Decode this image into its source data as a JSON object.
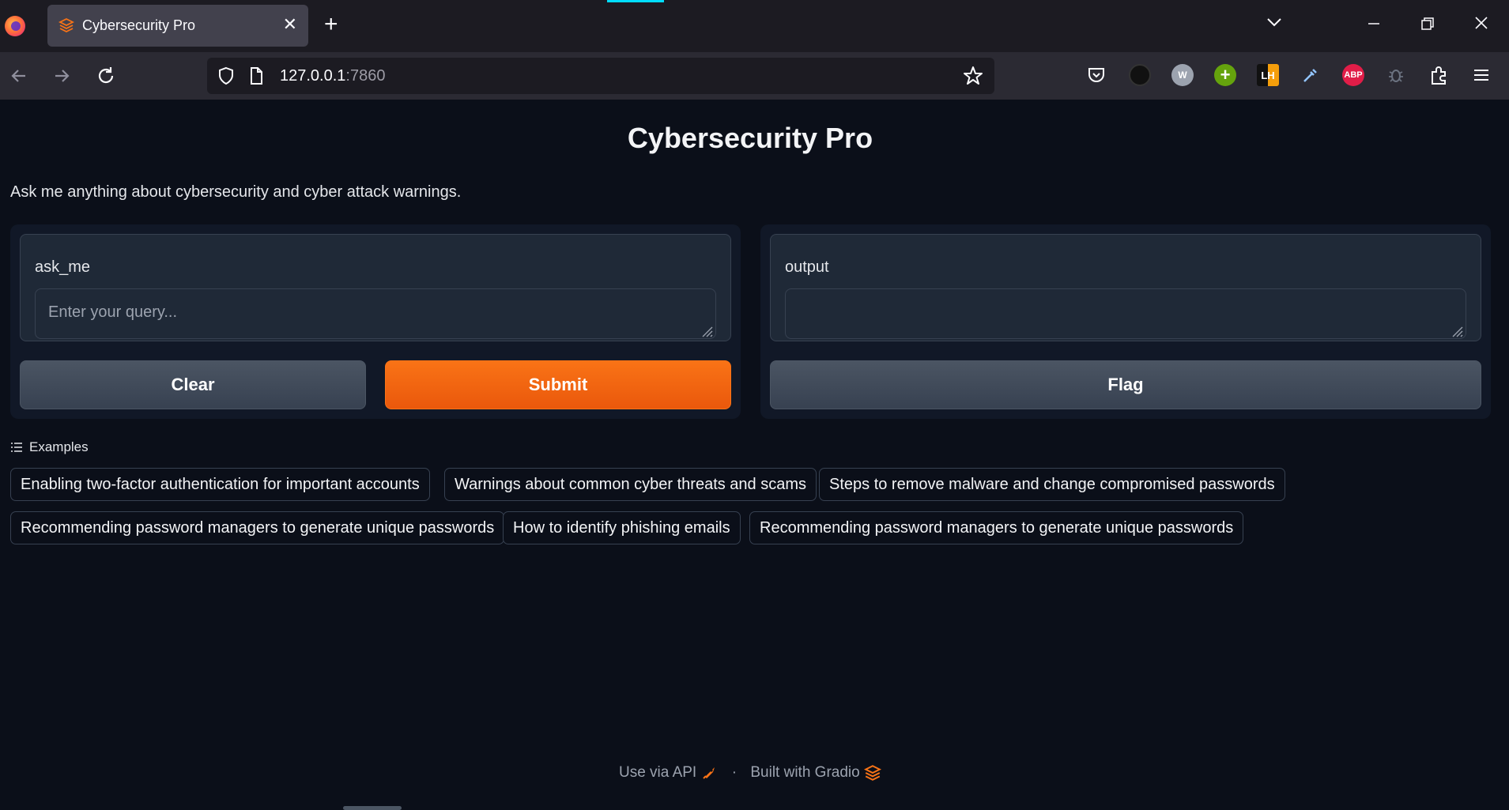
{
  "browser": {
    "tab_title": "Cybersecurity Pro",
    "url_host": "127.0.0.1",
    "url_port": ":7860",
    "extensions": [
      "pocket-icon",
      "dark-reader-icon",
      "w-extension-icon",
      "plus-extension-icon",
      "lighthouse-icon",
      "eyedropper-icon",
      "adblock-plus-icon",
      "bug-icon",
      "extensions-icon",
      "menu-icon"
    ],
    "adblock_label": "ABP",
    "w_label": "W",
    "lh_label": "LH"
  },
  "app": {
    "title": "Cybersecurity Pro",
    "description": "Ask me anything about cybersecurity and cyber attack warnings.",
    "input": {
      "label": "ask_me",
      "placeholder": "Enter your query...",
      "value": ""
    },
    "output": {
      "label": "output",
      "value": ""
    },
    "buttons": {
      "clear": "Clear",
      "submit": "Submit",
      "flag": "Flag"
    },
    "examples_label": "Examples",
    "examples": [
      "Enabling two-factor authentication for important accounts",
      "Warnings about common cyber threats and scams",
      "Steps to remove malware and change compromised passwords",
      "Recommending password managers to generate unique passwords",
      "How to identify phishing emails",
      "Recommending password managers to generate unique passwords"
    ],
    "footer": {
      "api": "Use via API",
      "separator": "·",
      "built_with": "Built with Gradio"
    },
    "colors": {
      "primary": "#f97316",
      "background": "#0b0f19",
      "panel": "#111827"
    }
  }
}
